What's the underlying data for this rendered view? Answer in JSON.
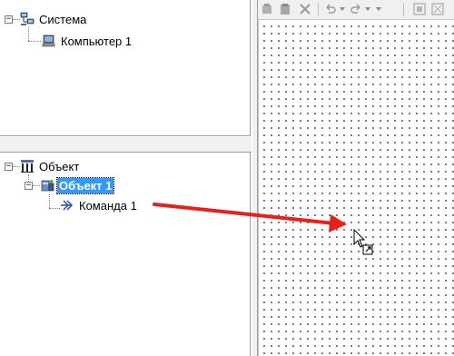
{
  "tree_top": {
    "root": {
      "label": "Система",
      "expander": "−",
      "icon": "network-computers-icon"
    },
    "child": {
      "label": "Компьютер 1",
      "icon": "computer-icon"
    }
  },
  "tree_bottom": {
    "root": {
      "label": "Объект",
      "expander": "−",
      "icon": "object-grid-icon"
    },
    "child": {
      "label": "Объект 1",
      "expander": "−",
      "icon": "object-device-icon",
      "selected": true
    },
    "grandchild": {
      "label": "Команда 1",
      "icon": "command-arrow-icon"
    }
  },
  "toolbar": {
    "buttons": [
      "cut-icon",
      "paste-icon",
      "delete-icon",
      "undo-icon",
      "undo-dropdown-icon",
      "redo-icon",
      "redo-dropdown-icon",
      "zoom-in-icon",
      "zoom-fit-icon"
    ]
  },
  "annotation": {
    "arrow_color": "#e8201a"
  },
  "colors": {
    "selection": "#3399ff",
    "arrow": "#e8201a"
  }
}
